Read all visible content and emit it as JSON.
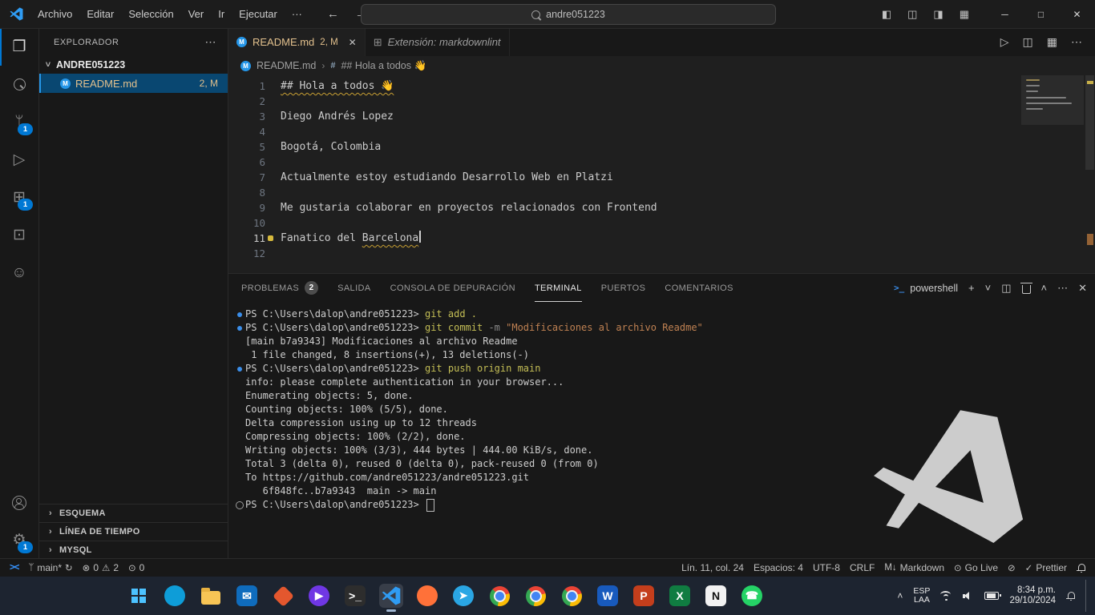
{
  "colors": {
    "accent": "#0078d4",
    "modified": "#e2c08d",
    "warning": "#d7ba3d",
    "selection_bg": "#094771"
  },
  "titlebar": {
    "menus": [
      "Archivo",
      "Editar",
      "Selección",
      "Ver",
      "Ir",
      "Ejecutar"
    ],
    "more_label": "···",
    "search_value": "andre051223",
    "layout_icons": [
      "toggle-sidebar",
      "toggle-panel",
      "toggle-secondary-sidebar",
      "customize-layout"
    ],
    "window_buttons": [
      "minimize",
      "maximize",
      "close"
    ]
  },
  "activitybar": {
    "items": [
      {
        "name": "explorer",
        "icon": "files",
        "active": true,
        "badge": ""
      },
      {
        "name": "search",
        "icon": "search",
        "badge": ""
      },
      {
        "name": "source-control",
        "icon": "branch",
        "badge": "1"
      },
      {
        "name": "run-debug",
        "icon": "run",
        "badge": ""
      },
      {
        "name": "extensions",
        "icon": "extensions",
        "badge": "1"
      },
      {
        "name": "remote-explorer",
        "icon": "remote-box",
        "badge": ""
      },
      {
        "name": "feedback",
        "icon": "chat",
        "badge": ""
      }
    ],
    "bottom": [
      {
        "name": "account",
        "icon": "account",
        "badge": ""
      },
      {
        "name": "settings",
        "icon": "gear",
        "badge": "1"
      }
    ]
  },
  "sidebar": {
    "title": "EXPLORADOR",
    "folder": "ANDRE051223",
    "file": {
      "name": "README.md",
      "badge": "2, M"
    },
    "bottom_sections": [
      "ESQUEMA",
      "LÍNEA DE TIEMPO",
      "MYSQL"
    ]
  },
  "editor": {
    "tabs": [
      {
        "label": "README.md",
        "badge": "2, M",
        "active": true,
        "closable": true
      },
      {
        "label": "Extensión: markdownlint",
        "preview": true
      }
    ],
    "actions": [
      {
        "name": "run-button",
        "icon": "play"
      },
      {
        "name": "split-editor-button",
        "icon": "split"
      },
      {
        "name": "customize-layout-button",
        "icon": "grid"
      },
      {
        "name": "more-actions-button",
        "icon": "kebab"
      }
    ],
    "breadcrumb": {
      "file": "README.md",
      "symbol": "## Hola a todos 👋"
    },
    "lines": [
      {
        "n": 1,
        "text": "## Hola a todos 👋",
        "squiggle": "all"
      },
      {
        "n": 2,
        "text": ""
      },
      {
        "n": 3,
        "text": "Diego Andrés Lopez"
      },
      {
        "n": 4,
        "text": ""
      },
      {
        "n": 5,
        "text": "Bogotá, Colombia"
      },
      {
        "n": 6,
        "text": ""
      },
      {
        "n": 7,
        "text": "Actualmente estoy estudiando Desarrollo Web en Platzi"
      },
      {
        "n": 8,
        "text": ""
      },
      {
        "n": 9,
        "text": "Me gustaria colaborar en proyectos relacionados con Frontend"
      },
      {
        "n": 10,
        "text": ""
      },
      {
        "n": 11,
        "text": "Fanatico del Barcelona",
        "squiggle": "last",
        "cursor": true,
        "active": true,
        "bulb": true
      },
      {
        "n": 12,
        "text": ""
      }
    ]
  },
  "panel": {
    "tabs": [
      {
        "label": "PROBLEMAS",
        "badge": "2"
      },
      {
        "label": "SALIDA"
      },
      {
        "label": "CONSOLA DE DEPURACIÓN"
      },
      {
        "label": "TERMINAL",
        "active": true
      },
      {
        "label": "PUERTOS"
      },
      {
        "label": "COMENTARIOS"
      }
    ],
    "shell_label": "powershell",
    "tool_icons": [
      {
        "name": "new-terminal-button",
        "icon": "plus"
      },
      {
        "name": "launch-profile-dropdown",
        "icon": "chevron-down"
      },
      {
        "name": "split-terminal-button",
        "icon": "split"
      },
      {
        "name": "kill-terminal-button",
        "icon": "trash"
      },
      {
        "name": "maximize-panel-button",
        "icon": "chevron-up"
      },
      {
        "name": "more-actions-button",
        "icon": "kebab"
      },
      {
        "name": "close-panel-button",
        "icon": "close"
      }
    ],
    "terminal_lines": [
      {
        "dec": "blue",
        "segs": [
          {
            "c": "fg",
            "t": "PS C:\\Users\\dalop\\andre051223> "
          },
          {
            "c": "cmd",
            "t": "git add ."
          }
        ]
      },
      {
        "dec": "blue",
        "segs": [
          {
            "c": "fg",
            "t": "PS C:\\Users\\dalop\\andre051223> "
          },
          {
            "c": "cmd",
            "t": "git commit"
          },
          {
            "c": "param",
            "t": " -m "
          },
          {
            "c": "str",
            "t": "\"Modificaciones al archivo Readme\""
          }
        ]
      },
      {
        "segs": [
          {
            "c": "fg",
            "t": "[main b7a9343] Modificaciones al archivo Readme"
          }
        ]
      },
      {
        "segs": [
          {
            "c": "fg",
            "t": " 1 file changed, 8 insertions(+), 13 deletions(-)"
          }
        ]
      },
      {
        "dec": "blue",
        "segs": [
          {
            "c": "fg",
            "t": "PS C:\\Users\\dalop\\andre051223> "
          },
          {
            "c": "cmd",
            "t": "git push origin main"
          }
        ]
      },
      {
        "segs": [
          {
            "c": "fg",
            "t": "info: please complete authentication in your browser..."
          }
        ]
      },
      {
        "segs": [
          {
            "c": "fg",
            "t": "Enumerating objects: 5, done."
          }
        ]
      },
      {
        "segs": [
          {
            "c": "fg",
            "t": "Counting objects: 100% (5/5), done."
          }
        ]
      },
      {
        "segs": [
          {
            "c": "fg",
            "t": "Delta compression using up to 12 threads"
          }
        ]
      },
      {
        "segs": [
          {
            "c": "fg",
            "t": "Compressing objects: 100% (2/2), done."
          }
        ]
      },
      {
        "segs": [
          {
            "c": "fg",
            "t": "Writing objects: 100% (3/3), 444 bytes | 444.00 KiB/s, done."
          }
        ]
      },
      {
        "segs": [
          {
            "c": "fg",
            "t": "Total 3 (delta 0), reused 0 (delta 0), pack-reused 0 (from 0)"
          }
        ]
      },
      {
        "segs": [
          {
            "c": "fg",
            "t": "To https://github.com/andre051223/andre051223.git"
          }
        ]
      },
      {
        "segs": [
          {
            "c": "fg",
            "t": "   6f848fc..b7a9343  main -> main"
          }
        ]
      },
      {
        "dec": "gray",
        "cursor": true,
        "segs": [
          {
            "c": "fg",
            "t": "PS C:\\Users\\dalop\\andre051223> "
          }
        ]
      }
    ]
  },
  "statusbar": {
    "left": [
      {
        "name": "remote-indicator",
        "icon": "remote",
        "text": ""
      },
      {
        "name": "git-branch",
        "icon": "branch",
        "text": "main*",
        "icon2": "sync",
        "text2": ""
      },
      {
        "name": "problems",
        "icon": "error",
        "text": "0",
        "icon2": "warning",
        "text2": "2"
      },
      {
        "name": "ports-forwarded",
        "icon": "broadcast",
        "text": "0"
      }
    ],
    "right": [
      {
        "name": "cursor-position",
        "text": "Lín. 11, col. 24"
      },
      {
        "name": "indentation",
        "text": "Espacios: 4"
      },
      {
        "name": "encoding",
        "text": "UTF-8"
      },
      {
        "name": "eol-sequence",
        "text": "CRLF"
      },
      {
        "name": "language-mode",
        "icon": "markdown",
        "text": "Markdown"
      },
      {
        "name": "go-live",
        "icon": "broadcast",
        "text": "Go Live"
      },
      {
        "name": "circle-slash-indicator",
        "icon": "slash",
        "text": ""
      },
      {
        "name": "prettier",
        "icon": "check",
        "text": "Prettier"
      },
      {
        "name": "notifications",
        "icon": "bell",
        "text": ""
      }
    ]
  },
  "taskbar": {
    "icons": [
      {
        "name": "start-button",
        "type": "start"
      },
      {
        "name": "edge-icon",
        "type": "circle",
        "bg": "#0e9dd8",
        "glyph": ""
      },
      {
        "name": "file-explorer-icon",
        "type": "folder"
      },
      {
        "name": "outlook-icon",
        "type": "square",
        "bg": "#0f6cbd",
        "fg": "#ffffff",
        "glyph": "✉"
      },
      {
        "name": "photos-icon",
        "type": "diamond",
        "bg": "#e4572e"
      },
      {
        "name": "clipchamp-icon",
        "type": "circle",
        "bg": "#7037e4",
        "fg": "#ffffff",
        "glyph": "▶"
      },
      {
        "name": "windows-terminal-icon",
        "type": "square",
        "bg": "#2d2d2d",
        "fg": "#ffffff",
        "glyph": ">_"
      },
      {
        "name": "vscode-icon",
        "type": "vscode",
        "active": true
      },
      {
        "name": "firefox-icon",
        "type": "circle",
        "bg": "#ff7139",
        "glyph": ""
      },
      {
        "name": "telegram-icon",
        "type": "circle",
        "bg": "#2aa6e4",
        "fg": "#ffffff",
        "glyph": "➤"
      },
      {
        "name": "chrome-icon",
        "type": "chrome"
      },
      {
        "name": "chrome-profile-icon-1",
        "type": "chrome"
      },
      {
        "name": "chrome-profile-icon-2",
        "type": "chrome"
      },
      {
        "name": "word-icon",
        "type": "square",
        "bg": "#185abd",
        "fg": "#ffffff",
        "glyph": "W"
      },
      {
        "name": "powerpoint-icon",
        "type": "square",
        "bg": "#c43e1c",
        "fg": "#ffffff",
        "glyph": "P"
      },
      {
        "name": "excel-icon",
        "type": "square",
        "bg": "#107c41",
        "fg": "#ffffff",
        "glyph": "X"
      },
      {
        "name": "notion-icon",
        "type": "square",
        "bg": "#f2f2f2",
        "fg": "#111111",
        "glyph": "N"
      },
      {
        "name": "whatsapp-icon",
        "type": "circle",
        "bg": "#25d366",
        "fg": "#ffffff",
        "glyph": "☎"
      }
    ],
    "tray": {
      "language_line1": "ESP",
      "language_line2": "LAA",
      "time": "8:34 p.m.",
      "date": "29/10/2024"
    }
  }
}
